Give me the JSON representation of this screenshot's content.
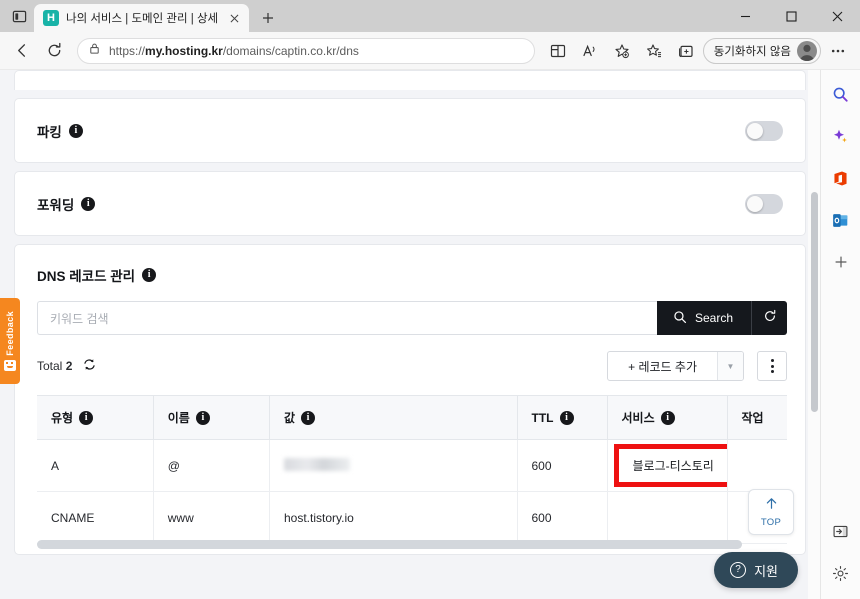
{
  "browser": {
    "tab": {
      "title": "나의 서비스 | 도메인 관리 | 상세",
      "favicon_letter": "H",
      "close_label": "✕"
    },
    "new_tab_label": "+",
    "window_controls": {
      "minimize": "—",
      "maximize": "▢",
      "close": "✕"
    },
    "address": {
      "url_prefix": "https://",
      "url_host": "my.hosting.kr",
      "url_path": "/domains/captin.co.kr/dns"
    },
    "profile": {
      "label": "동기화하지 않음"
    },
    "toolbar_icons": [
      "back-icon",
      "refresh-icon",
      "lock-icon",
      "split-screen-icon",
      "read-aloud-icon",
      "favorite-icon",
      "collections-icon",
      "browser-essentials-icon",
      "settings-more-icon"
    ]
  },
  "page": {
    "sections": [
      {
        "name": "parking",
        "label": "파킹",
        "toggle_on": false
      },
      {
        "name": "forwarding",
        "label": "포워딩",
        "toggle_on": false
      }
    ],
    "dns": {
      "title": "DNS 레코드 관리",
      "search": {
        "placeholder": "키워드 검색",
        "value": "",
        "button_label": "Search",
        "refresh_icon": "reset-icon"
      },
      "total_label": "Total",
      "total_count": "2",
      "add_record_label": "+ 레코드 추가",
      "dropdown_caret": "▼",
      "columns": [
        {
          "label": "유형",
          "info": true
        },
        {
          "label": "이름",
          "info": true
        },
        {
          "label": "값",
          "info": true
        },
        {
          "label": "TTL",
          "info": true
        },
        {
          "label": "서비스",
          "info": true
        },
        {
          "label": "작업",
          "info": false
        }
      ],
      "rows": [
        {
          "type": "A",
          "name": "@",
          "value": "",
          "value_blurred": true,
          "ttl": "600",
          "service": "블로그-티스토리",
          "service_highlighted": true,
          "action": ""
        },
        {
          "type": "CNAME",
          "name": "www",
          "value": "host.tistory.io",
          "value_blurred": false,
          "ttl": "600",
          "service": "",
          "service_highlighted": false,
          "action": ""
        }
      ]
    },
    "feedback_tab": {
      "label": "Feedback"
    },
    "top_button": {
      "label": "TOP"
    },
    "support_button": {
      "label": "지원"
    }
  },
  "edge_sidebar": {
    "top_icons": [
      "search-icon",
      "copilot-icon",
      "office-icon",
      "outlook-icon",
      "add-tool-icon"
    ],
    "bottom_icons": [
      "expand-panel-icon",
      "settings-gear-icon"
    ],
    "add_label": "+"
  },
  "colors": {
    "accent_dark": "#15181d",
    "highlight_red": "#ee1111",
    "feedback_orange": "#f5871f",
    "support_teal": "#2f4858",
    "favicon_teal": "#18b3a7"
  }
}
